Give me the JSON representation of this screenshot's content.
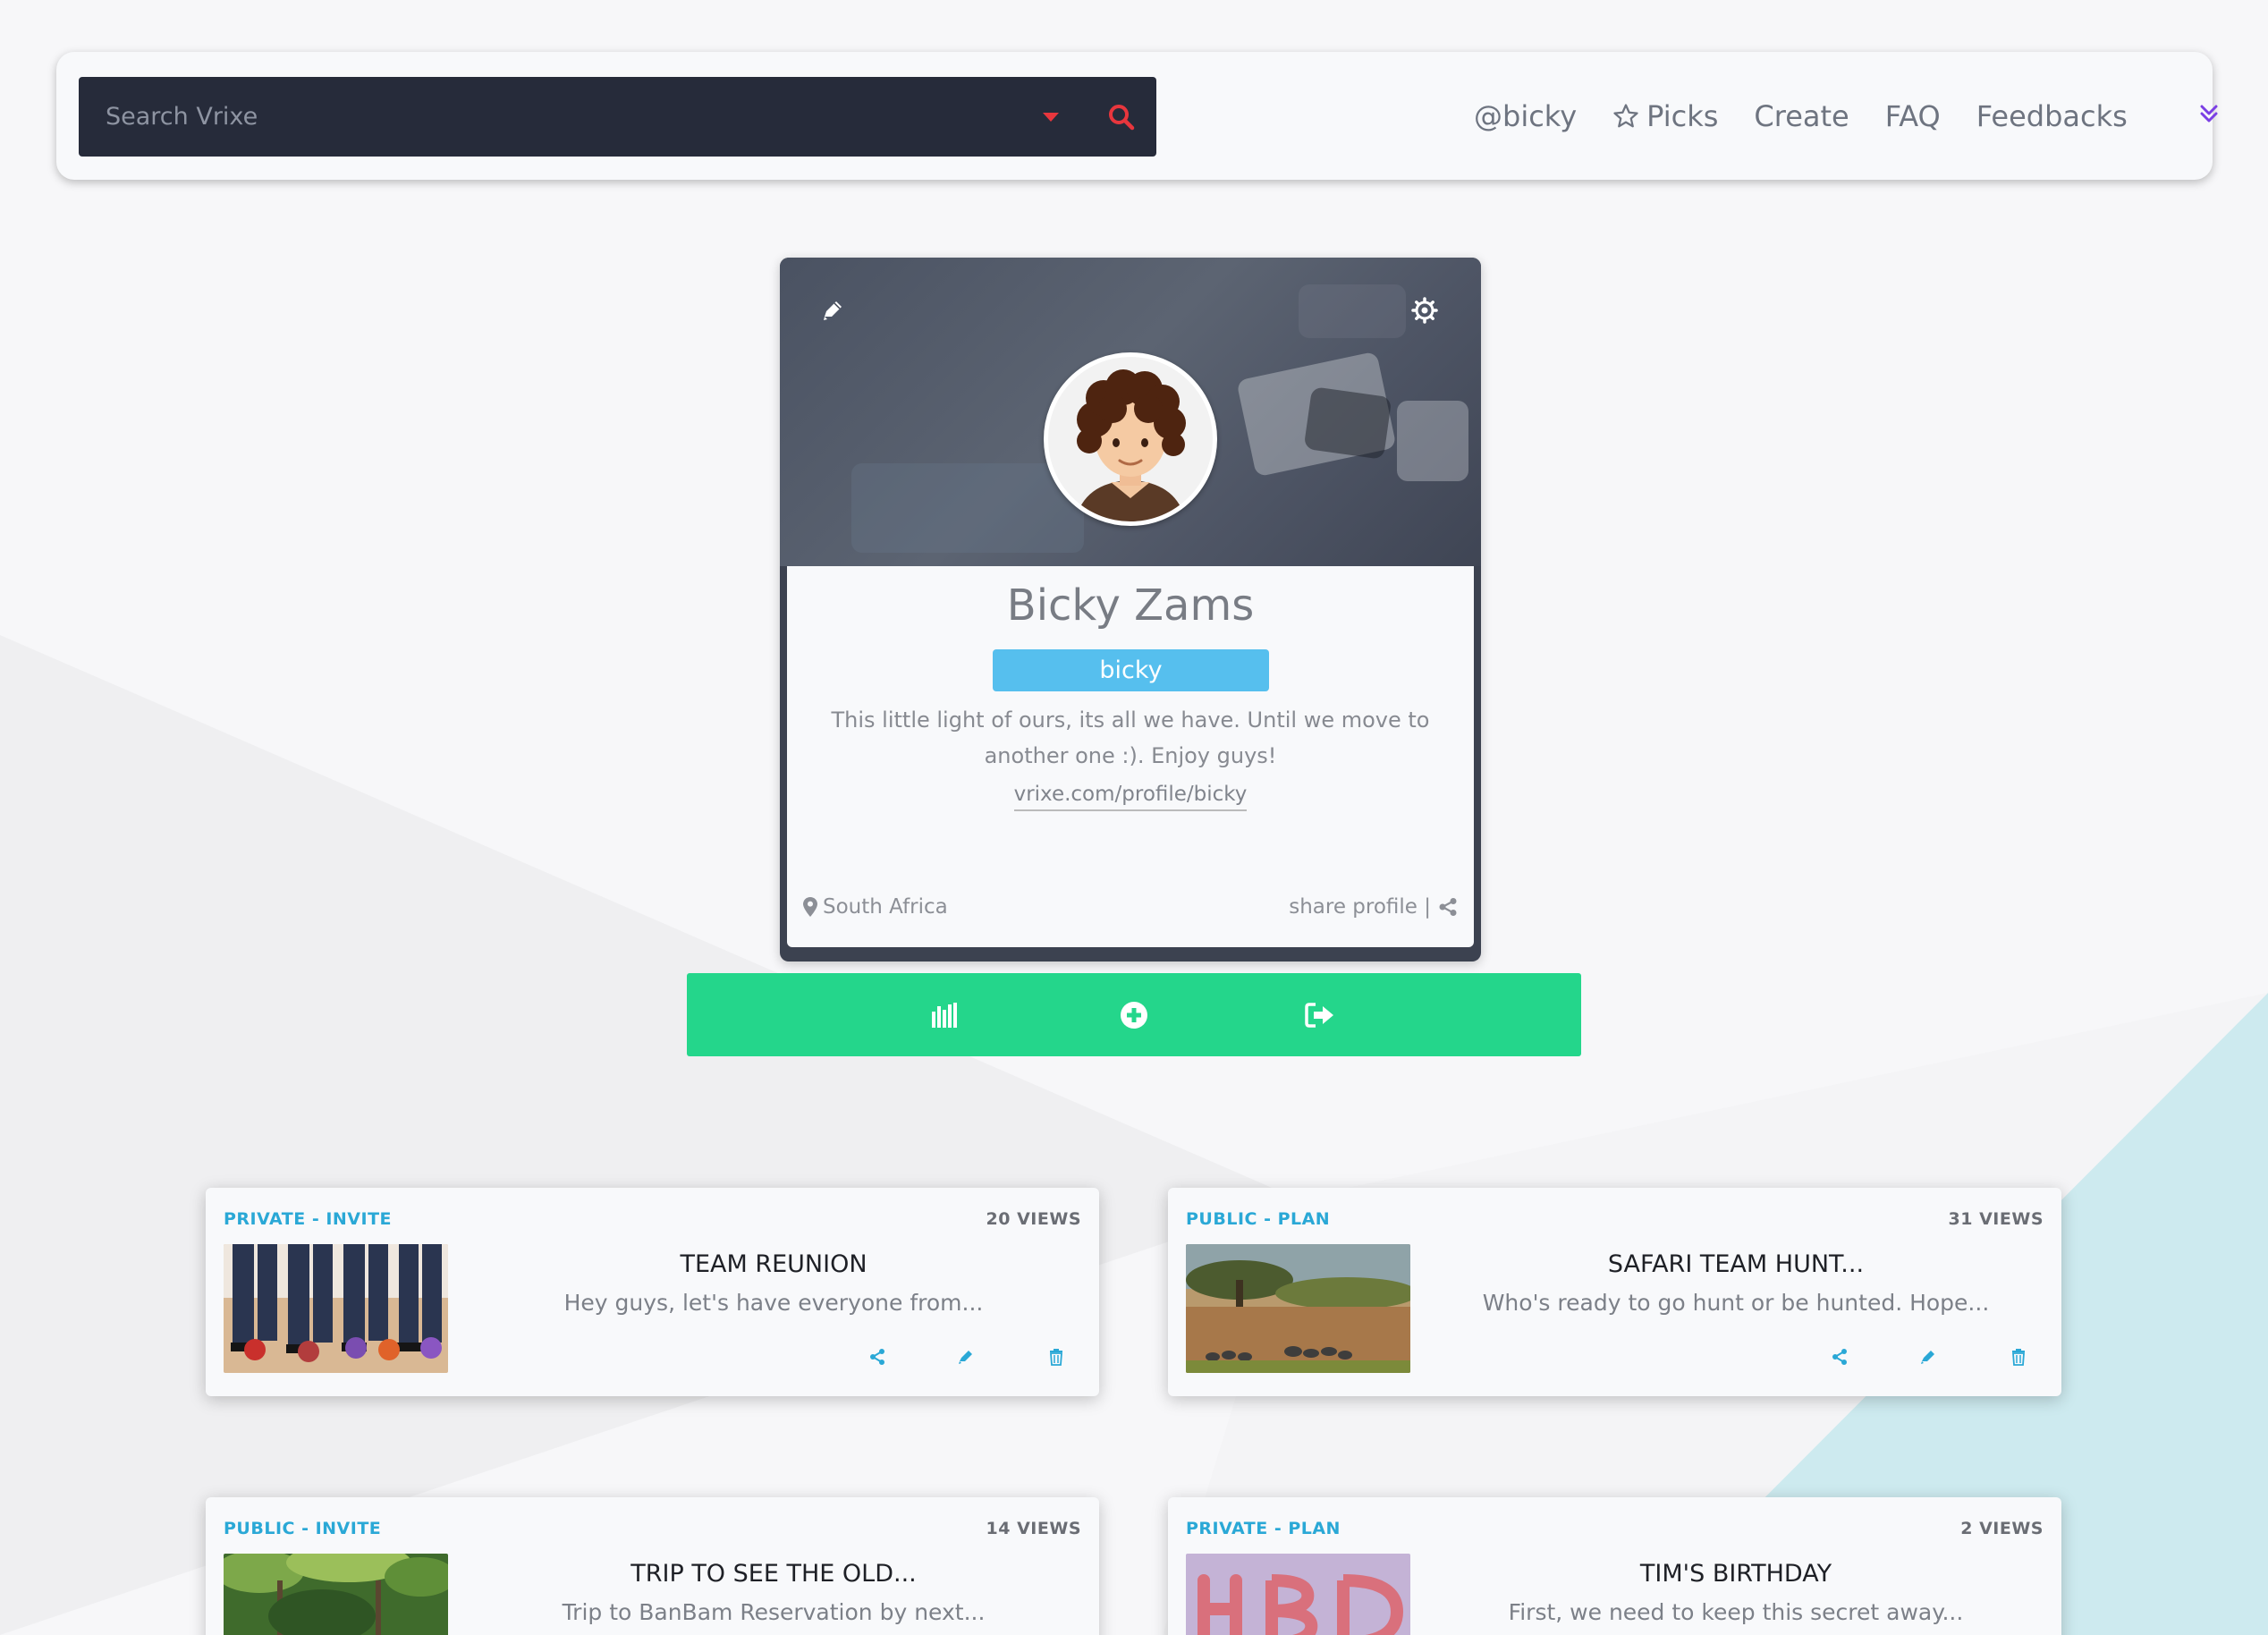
{
  "colors": {
    "accent_green": "#24d68b",
    "accent_blue": "#56bfee",
    "tag_blue": "#2aa8d6",
    "search_bg": "#262b3a",
    "search_accent": "#e8363d",
    "nav_toggle": "#7b3fe4"
  },
  "search": {
    "placeholder": "Search Vrixe"
  },
  "nav": {
    "username": "@bicky",
    "picks": "Picks",
    "create": "Create",
    "faq": "FAQ",
    "feedbacks": "Feedbacks"
  },
  "profile": {
    "name": "Bicky Zams",
    "username": "bicky",
    "bio": "This little light of ours, its all we have. Until we move to another one :). Enjoy guys!",
    "link": "vrixe.com/profile/bicky",
    "location": "South Africa",
    "share_label": "share profile |"
  },
  "icons": {
    "search": "search-icon",
    "dropdown": "caret-down-icon",
    "picks": "star-icon",
    "nav_toggle": "double-chevron-down-icon",
    "edit": "pencil-icon",
    "settings": "gear-icon",
    "location": "map-marker-icon",
    "share": "share-icon",
    "stats": "bar-chart-icon",
    "add": "plus-circle-icon",
    "logout": "sign-out-icon",
    "delete": "trash-icon"
  },
  "events": [
    {
      "tag": "PRIVATE - INVITE",
      "views": "20 VIEWS",
      "title": "TEAM REUNION",
      "desc": "Hey guys, let's have everyone from...",
      "thumb": "bowling-photo"
    },
    {
      "tag": "PUBLIC - PLAN",
      "views": "31 VIEWS",
      "title": "SAFARI TEAM HUNT...",
      "desc": "Who's ready to go hunt or be hunted. Hope...",
      "thumb": "safari-photo"
    },
    {
      "tag": "PUBLIC - INVITE",
      "views": "14 VIEWS",
      "title": "TRIP TO SEE THE OLD...",
      "desc": "Trip to BanBam Reservation by next...",
      "thumb": "forest-photo"
    },
    {
      "tag": "PRIVATE - PLAN",
      "views": "2 VIEWS",
      "title": "TIM'S BIRTHDAY",
      "desc": "First, we need to keep this secret away...",
      "thumb": "hbd-balloons-photo"
    }
  ]
}
